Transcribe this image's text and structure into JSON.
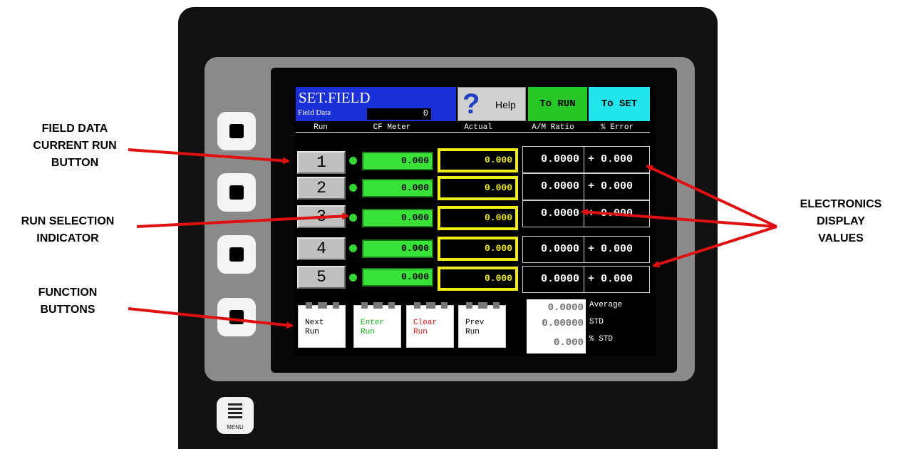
{
  "annotations": {
    "field_data_current_run": [
      "FIELD DATA",
      "CURRENT RUN",
      "BUTTON"
    ],
    "run_selection": [
      "RUN SELECTION",
      "INDICATOR"
    ],
    "function_buttons": [
      "FUNCTION",
      "BUTTONS"
    ],
    "electronics_display": [
      "ELECTRONICS",
      "DISPLAY",
      "VALUES"
    ]
  },
  "screen": {
    "title": "SET.FIELD",
    "field_data_label": "Field Data",
    "field_data_value": "0",
    "help_label": "Help",
    "to_run_label": "To RUN",
    "to_set_label": "To SET",
    "headers": {
      "run": "Run",
      "cf_meter": "CF Meter",
      "actual": "Actual",
      "am_ratio": "A/M Ratio",
      "error": "% Error"
    },
    "rows": [
      {
        "run": "1",
        "cf_meter": "0.000",
        "actual": "0.000",
        "ratio": "0.0000",
        "error": "+ 0.000"
      },
      {
        "run": "2",
        "cf_meter": "0.000",
        "actual": "0.000",
        "ratio": "0.0000",
        "error": "+ 0.000"
      },
      {
        "run": "3",
        "cf_meter": "0.000",
        "actual": "0.000",
        "ratio": "0.0000",
        "error": "+ 0.000"
      },
      {
        "run": "4",
        "cf_meter": "0.000",
        "actual": "0.000",
        "ratio": "0.0000",
        "error": "+ 0.000"
      },
      {
        "run": "5",
        "cf_meter": "0.000",
        "actual": "0.000",
        "ratio": "0.0000",
        "error": "+ 0.000"
      }
    ],
    "function_buttons": [
      {
        "line1": "Next",
        "line2": "Run",
        "color": "#000000"
      },
      {
        "line1": "Enter",
        "line2": "Run",
        "color": "#18b818"
      },
      {
        "line1": "Clear",
        "line2": "Run",
        "color": "#e01818"
      },
      {
        "line1": "Prev",
        "line2": "Run",
        "color": "#000000"
      }
    ],
    "stats": [
      {
        "value": "0.0000",
        "label": "Average"
      },
      {
        "value": "0.00000",
        "label": "STD"
      },
      {
        "value": "0.000",
        "label": "% STD"
      }
    ]
  },
  "menu_label": "MENU",
  "colors": {
    "title_bg": "#1a2fd6",
    "to_run_bg": "#26c826",
    "to_set_bg": "#22e4ec",
    "actual_frame": "#f0ec18",
    "cf_meter_bg": "#38e238",
    "arrow": "#e01010"
  }
}
